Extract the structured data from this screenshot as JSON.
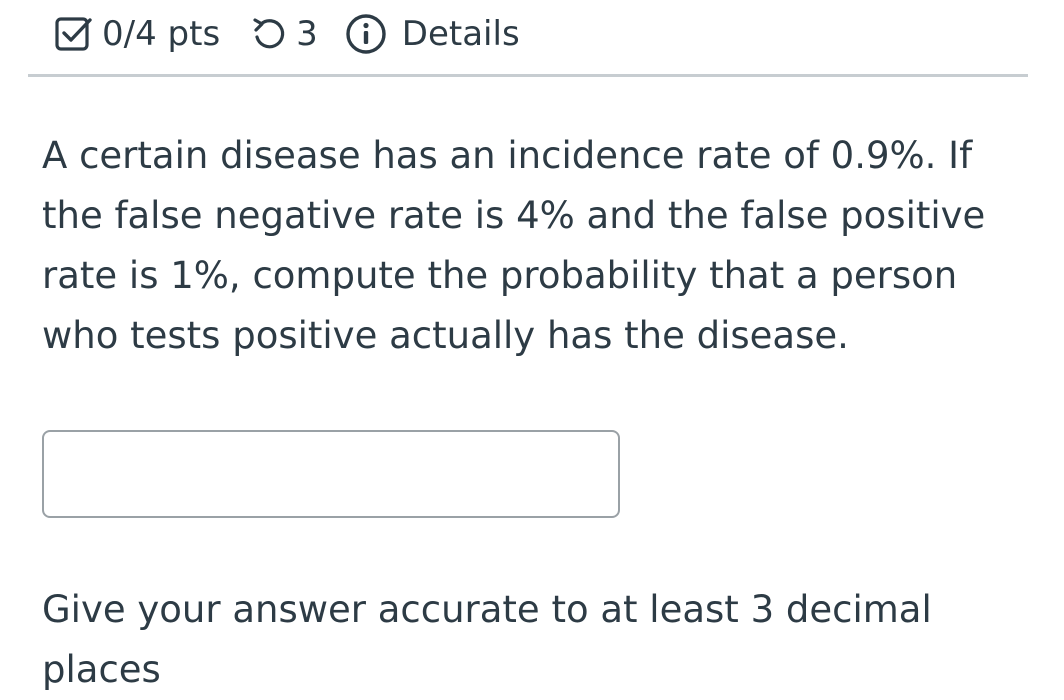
{
  "header": {
    "score_icon": "checkbox-check-icon",
    "score": "0/4 pts",
    "retry_icon": "retry-icon",
    "attempts": "3",
    "info_icon": "info-icon",
    "details_label": "Details"
  },
  "question": {
    "text": "A certain disease has an incidence rate of 0.9%. If the false negative rate is 4% and the false positive rate is 1%, compute the probability that a person who tests positive actually has the disease."
  },
  "answer": {
    "value": "",
    "placeholder": ""
  },
  "instruction": {
    "text": "Give your answer accurate to at least 3 decimal places"
  },
  "colors": {
    "text": "#2d3b45",
    "divider": "#c7cdd1",
    "input_border": "#9aa1a6"
  }
}
